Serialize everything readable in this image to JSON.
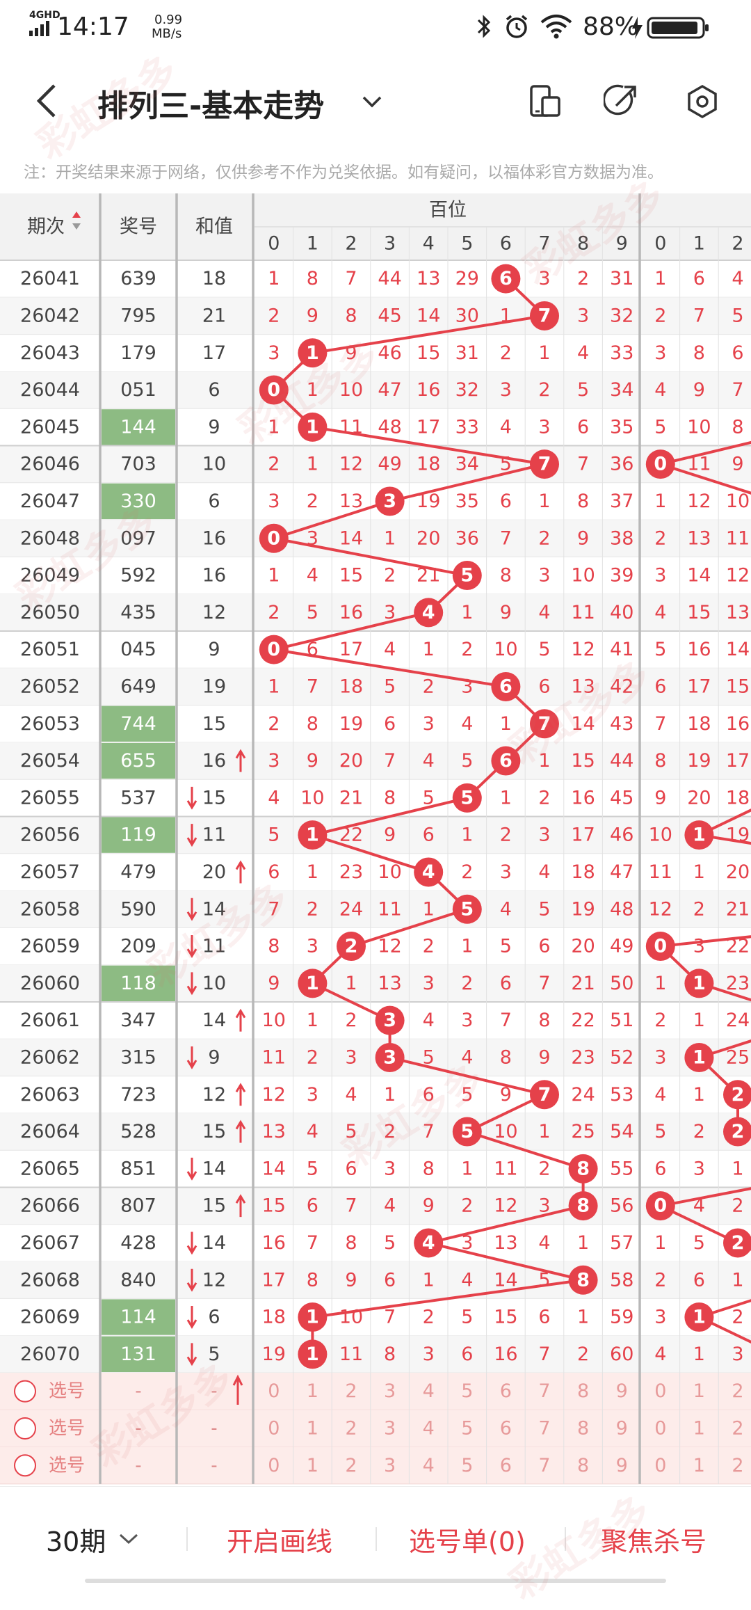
{
  "status": {
    "network": "4GHD",
    "time": "14:17",
    "speed_value": "0.99",
    "speed_unit": "MB/s",
    "battery": "88%"
  },
  "header": {
    "title": "排列三-基本走势"
  },
  "notice": "注：开奖结果来源于网络，仅供参考不作为兑奖依据。如有疑问，以福体彩官方数据为准。",
  "table": {
    "col_period": "期次",
    "col_number": "奖号",
    "col_sum": "和值",
    "group_hundreds": "百位",
    "digits": [
      "0",
      "1",
      "2",
      "3",
      "4",
      "5",
      "6",
      "7",
      "8",
      "9"
    ],
    "tens_digits_visible": [
      "0",
      "1",
      "2"
    ],
    "periods": [
      "26041",
      "26042",
      "26043",
      "26044",
      "26045",
      "26046",
      "26047",
      "26048",
      "26049",
      "26050",
      "26051",
      "26052",
      "26053",
      "26054",
      "26055",
      "26056",
      "26057",
      "26058",
      "26059",
      "26060",
      "26061",
      "26062",
      "26063",
      "26064",
      "26065",
      "26066",
      "26067",
      "26068",
      "26069",
      "26070"
    ],
    "numbers": [
      "639",
      "795",
      "179",
      "051",
      "144",
      "703",
      "330",
      "097",
      "592",
      "435",
      "045",
      "649",
      "744",
      "655",
      "537",
      "119",
      "479",
      "590",
      "209",
      "118",
      "347",
      "315",
      "723",
      "528",
      "851",
      "807",
      "428",
      "840",
      "114",
      "131"
    ],
    "sums": [
      "18",
      "21",
      "17",
      "6",
      "9",
      "10",
      "6",
      "16",
      "16",
      "12",
      "9",
      "19",
      "15",
      "16",
      "15",
      "11",
      "20",
      "14",
      "11",
      "10",
      "14",
      "9",
      "12",
      "15",
      "14",
      "15",
      "14",
      "12",
      "6",
      "5"
    ],
    "highlighted_rows": [
      4,
      6,
      12,
      13,
      15,
      19,
      28,
      29
    ],
    "sum_trend": [
      "",
      "",
      "",
      "",
      "",
      "",
      "",
      "",
      "",
      "",
      "",
      "",
      "",
      "up",
      "down",
      "down",
      "up",
      "down",
      "down",
      "down",
      "up",
      "down",
      "up",
      "up",
      "down",
      "up",
      "down",
      "down",
      "down",
      "down"
    ],
    "hundreds_cells": [
      [
        "1",
        "8",
        "7",
        "44",
        "13",
        "29",
        "6",
        "3",
        "2",
        "31"
      ],
      [
        "2",
        "9",
        "8",
        "45",
        "14",
        "30",
        "1",
        "7",
        "3",
        "32"
      ],
      [
        "3",
        "1",
        "9",
        "46",
        "15",
        "31",
        "2",
        "1",
        "4",
        "33"
      ],
      [
        "0",
        "1",
        "10",
        "47",
        "16",
        "32",
        "3",
        "2",
        "5",
        "34"
      ],
      [
        "1",
        "1",
        "11",
        "48",
        "17",
        "33",
        "4",
        "3",
        "6",
        "35"
      ],
      [
        "2",
        "1",
        "12",
        "49",
        "18",
        "34",
        "5",
        "7",
        "7",
        "36"
      ],
      [
        "3",
        "2",
        "13",
        "3",
        "19",
        "35",
        "6",
        "1",
        "8",
        "37"
      ],
      [
        "0",
        "3",
        "14",
        "1",
        "20",
        "36",
        "7",
        "2",
        "9",
        "38"
      ],
      [
        "1",
        "4",
        "15",
        "2",
        "21",
        "5",
        "8",
        "3",
        "10",
        "39"
      ],
      [
        "2",
        "5",
        "16",
        "3",
        "4",
        "1",
        "9",
        "4",
        "11",
        "40"
      ],
      [
        "0",
        "6",
        "17",
        "4",
        "1",
        "2",
        "10",
        "5",
        "12",
        "41"
      ],
      [
        "1",
        "7",
        "18",
        "5",
        "2",
        "3",
        "6",
        "6",
        "13",
        "42"
      ],
      [
        "2",
        "8",
        "19",
        "6",
        "3",
        "4",
        "1",
        "7",
        "14",
        "43"
      ],
      [
        "3",
        "9",
        "20",
        "7",
        "4",
        "5",
        "6",
        "1",
        "15",
        "44"
      ],
      [
        "4",
        "10",
        "21",
        "8",
        "5",
        "5",
        "1",
        "2",
        "16",
        "45"
      ],
      [
        "5",
        "1",
        "22",
        "9",
        "6",
        "1",
        "2",
        "3",
        "17",
        "46"
      ],
      [
        "6",
        "1",
        "23",
        "10",
        "4",
        "2",
        "3",
        "4",
        "18",
        "47"
      ],
      [
        "7",
        "2",
        "24",
        "11",
        "1",
        "5",
        "4",
        "5",
        "19",
        "48"
      ],
      [
        "8",
        "3",
        "2",
        "12",
        "2",
        "1",
        "5",
        "6",
        "20",
        "49"
      ],
      [
        "9",
        "1",
        "1",
        "13",
        "3",
        "2",
        "6",
        "7",
        "21",
        "50"
      ],
      [
        "10",
        "1",
        "2",
        "3",
        "4",
        "3",
        "7",
        "8",
        "22",
        "51"
      ],
      [
        "11",
        "2",
        "3",
        "3",
        "5",
        "4",
        "8",
        "9",
        "23",
        "52"
      ],
      [
        "12",
        "3",
        "4",
        "1",
        "6",
        "5",
        "9",
        "7",
        "24",
        "53"
      ],
      [
        "13",
        "4",
        "5",
        "2",
        "7",
        "5",
        "10",
        "1",
        "25",
        "54"
      ],
      [
        "14",
        "5",
        "6",
        "3",
        "8",
        "1",
        "11",
        "2",
        "8",
        "55"
      ],
      [
        "15",
        "6",
        "7",
        "4",
        "9",
        "2",
        "12",
        "3",
        "8",
        "56"
      ],
      [
        "16",
        "7",
        "8",
        "5",
        "4",
        "3",
        "13",
        "4",
        "1",
        "57"
      ],
      [
        "17",
        "8",
        "9",
        "6",
        "1",
        "4",
        "14",
        "5",
        "8",
        "58"
      ],
      [
        "18",
        "1",
        "10",
        "7",
        "2",
        "5",
        "15",
        "6",
        "1",
        "59"
      ],
      [
        "19",
        "1",
        "11",
        "8",
        "3",
        "6",
        "16",
        "7",
        "2",
        "60"
      ]
    ],
    "tens_cells": [
      [
        "1",
        "6",
        "4"
      ],
      [
        "2",
        "7",
        "5"
      ],
      [
        "3",
        "8",
        "6"
      ],
      [
        "4",
        "9",
        "7"
      ],
      [
        "5",
        "10",
        "8"
      ],
      [
        "0",
        "11",
        "9"
      ],
      [
        "1",
        "12",
        "10"
      ],
      [
        "2",
        "13",
        "11"
      ],
      [
        "3",
        "14",
        "12"
      ],
      [
        "4",
        "15",
        "13"
      ],
      [
        "5",
        "16",
        "14"
      ],
      [
        "6",
        "17",
        "15"
      ],
      [
        "7",
        "18",
        "16"
      ],
      [
        "8",
        "19",
        "17"
      ],
      [
        "9",
        "20",
        "18"
      ],
      [
        "10",
        "1",
        "19"
      ],
      [
        "11",
        "1",
        "20"
      ],
      [
        "12",
        "2",
        "21"
      ],
      [
        "0",
        "3",
        "22"
      ],
      [
        "1",
        "1",
        "23"
      ],
      [
        "2",
        "1",
        "24"
      ],
      [
        "3",
        "1",
        "25"
      ],
      [
        "4",
        "1",
        "2"
      ],
      [
        "5",
        "2",
        "2"
      ],
      [
        "6",
        "3",
        "1"
      ],
      [
        "0",
        "4",
        "2"
      ],
      [
        "1",
        "5",
        "2"
      ],
      [
        "2",
        "6",
        "1"
      ],
      [
        "3",
        "1",
        "2"
      ],
      [
        "4",
        "1",
        "3"
      ]
    ],
    "select_label": "选号",
    "select_placeholder": "-",
    "select_rows": 3
  },
  "bottom": {
    "periods": "30期",
    "draw_line": "开启画线",
    "selection": "选号单(0)",
    "focus_kill": "聚焦杀号"
  },
  "watermark": "彩虹多多",
  "colors": {
    "accent": "#e5414a",
    "line": "#e5414a",
    "highlight": "#8dbb83",
    "selrow": "#fdecea",
    "header_bg": "#f2f2f2"
  }
}
